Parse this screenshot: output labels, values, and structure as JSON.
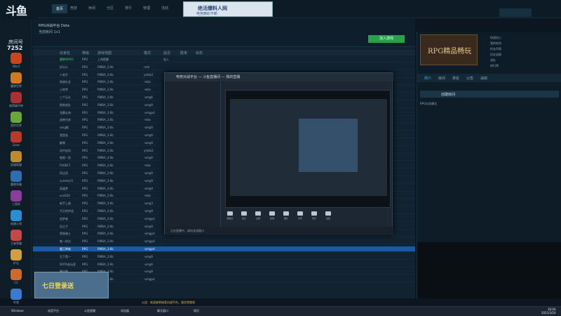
{
  "logo": {
    "text": "斗鱼",
    "room_label": "房间号",
    "room_id": "7252"
  },
  "nav_tabs": [
    "首页",
    "竞技",
    "休闲",
    "分区",
    "排行",
    "管理",
    "活动"
  ],
  "banner": {
    "title": "绝活爆料人网",
    "subtitle": "电竞精彩不断"
  },
  "sidebar": [
    {
      "label": "War3",
      "color": "#c8451d"
    },
    {
      "label": "魔兽世界",
      "color": "#cf7a21"
    },
    {
      "label": "暗黑破坏神",
      "color": "#a83232"
    },
    {
      "label": "我的世界",
      "color": "#6aa63a"
    },
    {
      "label": "Dota",
      "color": "#b83a2a"
    },
    {
      "label": "英雄联盟",
      "color": "#c08a2a"
    },
    {
      "label": "魔兽争霸",
      "color": "#2f6db0"
    },
    {
      "label": "三国杀",
      "color": "#8a3d9a"
    },
    {
      "label": "穿越火线",
      "color": "#2a8fd0"
    },
    {
      "label": "王者荣耀",
      "color": "#c04a4a"
    },
    {
      "label": "炉石",
      "color": "#d0a040"
    },
    {
      "label": "CS",
      "color": "#d06a2a"
    },
    {
      "label": "哔哩",
      "color": "#3a7ad0"
    }
  ],
  "infobar": {
    "line1": "RPG对战平台 Dota",
    "line2": "当前房间 1v1",
    "join_label": "加入游戏"
  },
  "table": {
    "headers": [
      "玩家名",
      "等级",
      "游戏地图",
      "模式",
      "延迟",
      "胜率",
      "状态"
    ],
    "rows": [
      [
        "魔兽WAR3",
        "RPG",
        "上线提醒",
        "-",
        "加入",
        "",
        ""
      ],
      [
        "好玩么",
        "RPG",
        "RMBA_3.6b",
        "rmb",
        "",
        "",
        ""
      ],
      [
        "人来开",
        "RPG",
        "RMBA_3.6b",
        "ymbk2",
        "",
        "",
        ""
      ],
      [
        "和谐社会",
        "RPG",
        "RMBA_3.6b",
        "-mbs",
        "",
        "",
        ""
      ],
      [
        "土地爷",
        "RPG",
        "RMBA_3.6b",
        "-mbs",
        "",
        "",
        ""
      ],
      [
        "三个石头",
        "RPG",
        "RMBA_3.6b",
        "-omg6",
        "",
        "",
        ""
      ],
      [
        "群狼战队",
        "RPG",
        "RMBA_3.6b",
        "-omg9",
        "",
        "",
        ""
      ],
      [
        "龙腾云海",
        "RPG",
        "RMBA_3.6b",
        "-omgpd",
        "",
        "",
        ""
      ],
      [
        "战神归来",
        "RPG",
        "RMBA_3.6b",
        "-mbs",
        "",
        "",
        ""
      ],
      [
        "omg都",
        "RPG",
        "RMBA_3.6b",
        "-omg9",
        "",
        "",
        ""
      ],
      [
        "我是谁",
        "RPG",
        "RMBA_3.6b",
        "-omg9",
        "",
        "",
        ""
      ],
      [
        "飘零",
        "RPG",
        "RMBA_3.6b",
        "-omg9",
        "",
        "",
        ""
      ],
      [
        "风中追风",
        "RPG",
        "RMBA_3.6b",
        "ymbk2",
        "",
        "",
        ""
      ],
      [
        "独孤一剑",
        "RPG",
        "RMBA_3.6b",
        "-omg9",
        "",
        "",
        ""
      ],
      [
        "FH0817",
        "RPG",
        "RMBA_3.6b",
        "-mbs",
        "",
        "",
        ""
      ],
      [
        "阿达西",
        "RPG",
        "RMBA_3.6b",
        "-omg9",
        "",
        "",
        ""
      ],
      [
        "summer5",
        "RPG",
        "RMBA_3.6b",
        "-omg9",
        "",
        "",
        ""
      ],
      [
        "英雄梦",
        "RPG",
        "RMBA_3.6b",
        "-omg9",
        "",
        "",
        ""
      ],
      [
        "sun024",
        "RPG",
        "RMBA_3.6b",
        "-mbs",
        "",
        "",
        ""
      ],
      [
        "新手上路",
        "RPG",
        "RMBA_3.6b",
        "-omg3",
        "",
        "",
        ""
      ],
      [
        "不灭的传说",
        "RPG",
        "RMBA_3.6b",
        "-omg9",
        "",
        "",
        ""
      ],
      [
        "追梦者",
        "RPG",
        "RMBA_3.6b",
        "-omgpd",
        "",
        "",
        ""
      ],
      [
        "风之子",
        "RPG",
        "RMBA_3.6b",
        "-omg9",
        "",
        "",
        ""
      ],
      [
        "黑暗骑士",
        "RPG",
        "RMBA_3.6b",
        "-omgpd",
        "",
        "",
        ""
      ],
      [
        "唯一的光",
        "RPG",
        "RMBA_3.6b",
        "-omgpd",
        "",
        "",
        ""
      ],
      [
        "魔王降临",
        "RPG",
        "RMBA_3.6b",
        "-omgpd",
        "",
        "",
        ""
      ],
      [
        "天下第一",
        "RPG",
        "RMBA_3.6b",
        "-omg9",
        "",
        "",
        ""
      ],
      [
        "DOTA老玩家",
        "RPG",
        "RMBA_3.6b",
        "-omg9",
        "",
        "",
        ""
      ],
      [
        "暴风雪",
        "RPG",
        "RMBA_3.6b",
        "-omg9",
        "",
        "",
        ""
      ],
      [
        "cut0907",
        "RPG",
        "RMBA_3.6b",
        "-omgpd",
        "",
        "",
        ""
      ]
    ],
    "selected_index": 25
  },
  "dialog": {
    "title": "电竞对战平台 — 斗鱼直播间 — 我的直播",
    "status": "正在直播中，请勿关闭窗口",
    "tools": [
      "摄像头",
      "窗口",
      "全屏",
      "区域",
      "图片",
      "文字",
      "音乐",
      "设置"
    ]
  },
  "right": {
    "rpg_title": "RPG精品畅玩",
    "links": [
      "快速加入",
      "我的房间",
      "好友列表",
      "历史战绩",
      "战队",
      "排行榜"
    ],
    "tabs": [
      "简介",
      "房间",
      "排名",
      "公告",
      "战绩"
    ],
    "subtab": "创建房间",
    "desc": "RPG对战模式"
  },
  "bottom_ad": {
    "text": "七日登录送"
  },
  "notice": "公告：欢迎来到电竞对战平台，请文明游戏",
  "taskbar": [
    {
      "label": "Windows"
    },
    {
      "label": "电竞平台"
    },
    {
      "label": "斗鱼直播"
    },
    {
      "label": "浏览器"
    },
    {
      "label": "聊天窗口"
    },
    {
      "label": "网页"
    }
  ],
  "clock": {
    "time": "16:04",
    "date": "2021/3/24"
  }
}
